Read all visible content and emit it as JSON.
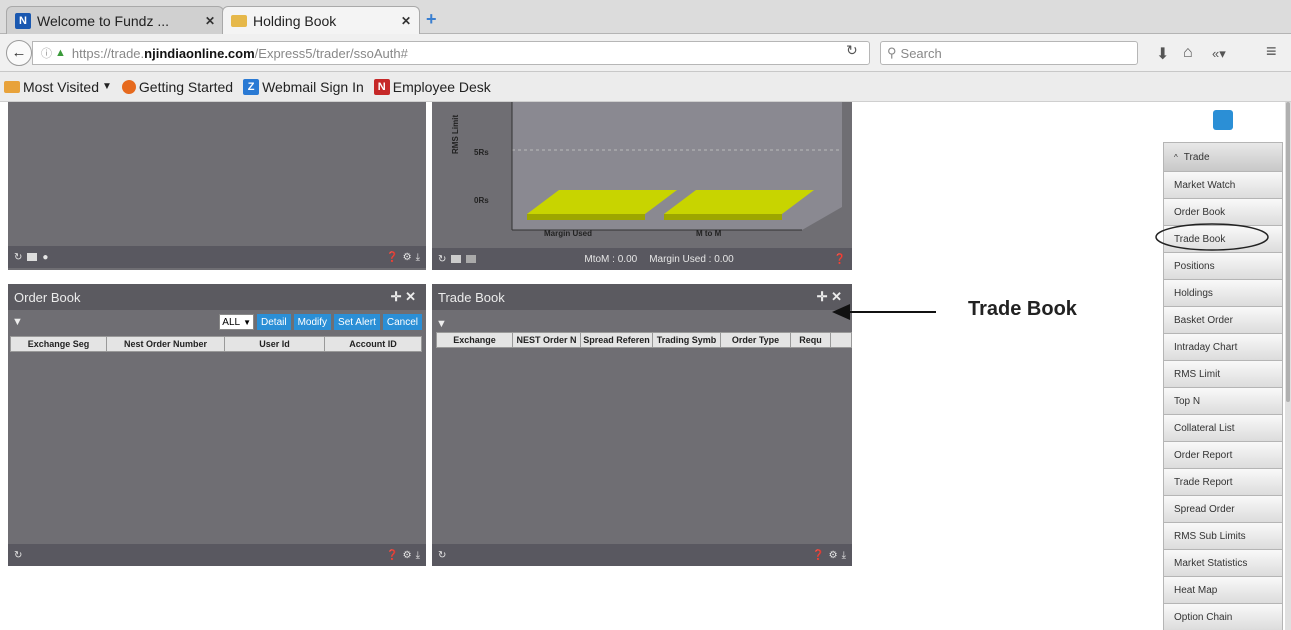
{
  "browser": {
    "tabs": [
      {
        "label": "Welcome to Fundz ..."
      },
      {
        "label": "Holding Book"
      }
    ],
    "url_prefix": "https://trade.",
    "url_domain": "njindiaonline.com",
    "url_suffix": "/Express5/trader/ssoAuth#",
    "search_placeholder": "Search",
    "bookmarks": [
      "Most Visited",
      "Getting Started",
      "Webmail Sign In",
      "Employee Desk"
    ]
  },
  "chart_panel": {
    "ylabel": "RMS Limit",
    "yticks": [
      "5Rs",
      "0Rs"
    ],
    "xlabels": [
      "Margin Used",
      "M to M"
    ],
    "mtom_label": "MtoM : 0.00",
    "margin_used_label": "Margin Used : 0.00"
  },
  "order_book": {
    "title": "Order Book",
    "filter": "ALL",
    "buttons": [
      "Detail",
      "Modify",
      "Set Alert",
      "Cancel"
    ],
    "columns": [
      "Exchange Seg",
      "Nest Order Number",
      "User Id",
      "Account ID"
    ]
  },
  "trade_book": {
    "title": "Trade Book",
    "columns": [
      "Exchange",
      "NEST Order N",
      "Spread Referen",
      "Trading Symb",
      "Order Type",
      "Requ"
    ]
  },
  "annotation": "Trade Book",
  "sidebar": {
    "header": "Trade",
    "items": [
      "Market Watch",
      "Order Book",
      "Trade Book",
      "Positions",
      "Holdings",
      "Basket Order",
      "Intraday Chart",
      "RMS Limit",
      "Top N",
      "Collateral List",
      "Order Report",
      "Trade Report",
      "Spread Order",
      "RMS Sub Limits",
      "Market Statistics",
      "Heat Map",
      "Option Chain"
    ]
  },
  "colors": {
    "accent": "#2b8fd6",
    "panel": "#6f6e73",
    "chart_bar": "#c8d400"
  }
}
